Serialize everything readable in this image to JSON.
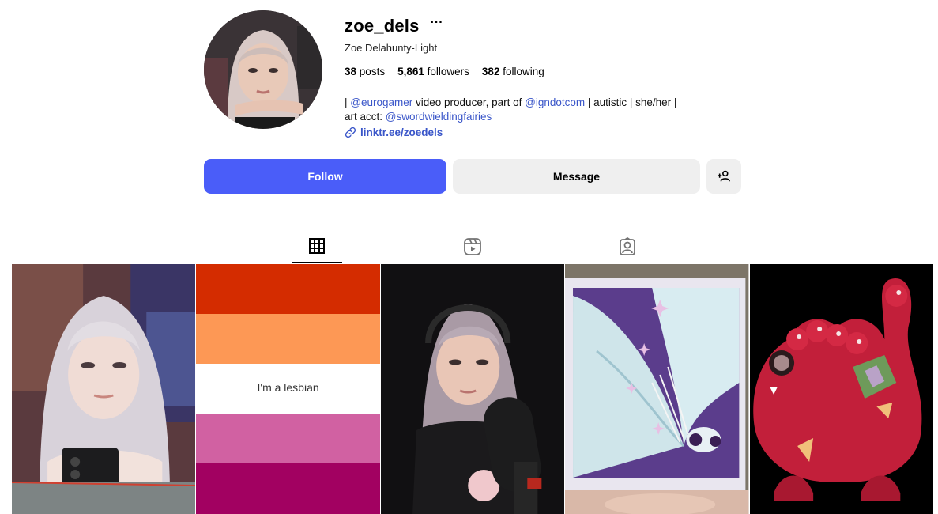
{
  "profile": {
    "username": "zoe_dels",
    "more_label": "···",
    "full_name": "Zoe Delahunty-Light",
    "stats": {
      "posts_count": "38",
      "posts_label": "posts",
      "followers_count": "5,861",
      "followers_label": "followers",
      "following_count": "382",
      "following_label": "following"
    },
    "bio": {
      "line1_prefix": "| ",
      "mention1": "@eurogamer",
      "line1_mid": " video producer, part of ",
      "mention2": "@igndotcom",
      "line1_suffix": " | autistic | she/her |",
      "line2_prefix": "art acct: ",
      "mention3": "@swordwieldingfairies"
    },
    "link": "linktr.ee/zoedels"
  },
  "actions": {
    "follow_label": "Follow",
    "message_label": "Message",
    "add_user_icon": "add-person-icon"
  },
  "tabs": [
    {
      "name": "posts",
      "icon": "grid-icon",
      "active": true
    },
    {
      "name": "reels",
      "icon": "reels-icon",
      "active": false
    },
    {
      "name": "tagged",
      "icon": "tagged-icon",
      "active": false
    }
  ],
  "posts": [
    {
      "type": "photo",
      "description_visible": false
    },
    {
      "type": "flag",
      "text": "I'm a lesbian",
      "colors": [
        "#d42c00",
        "#fd9855",
        "#ffffff",
        "#d161a2",
        "#a20161"
      ]
    },
    {
      "type": "photo"
    },
    {
      "type": "artwork"
    },
    {
      "type": "artwork"
    }
  ],
  "colors": {
    "accent": "#4a5df9",
    "link": "#3a56c9",
    "button_secondary": "#efefef"
  }
}
